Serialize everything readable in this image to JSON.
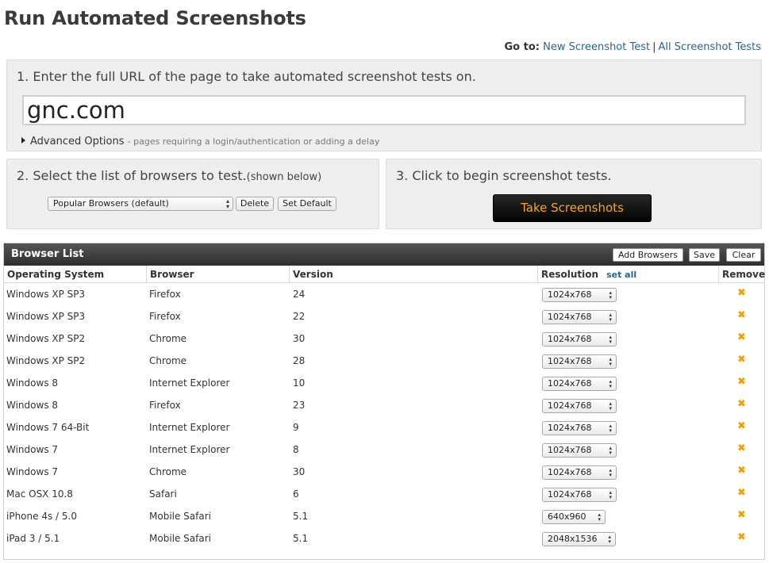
{
  "page": {
    "title": "Run Automated Screenshots"
  },
  "goto": {
    "label": "Go to:",
    "links": [
      "New Screenshot Test",
      "All Screenshot Tests"
    ],
    "separator": "|"
  },
  "step1": {
    "text": "1. Enter the full URL of the page to take automated screenshot tests on.",
    "url_value": "gnc.com",
    "advanced_label": "Advanced Options",
    "advanced_desc": "- pages requiring a login/authentication or adding a delay"
  },
  "step2": {
    "text": "2. Select the list of browsers to test.",
    "suffix": "(shown below)",
    "selected_list": "Popular Browsers (default)",
    "delete_label": "Delete",
    "set_default_label": "Set Default"
  },
  "step3": {
    "text": "3. Click to begin screenshot tests.",
    "button_label": "Take Screenshots",
    "button_text_color": "#f5a623"
  },
  "browser_list": {
    "title": "Browser List",
    "add_label": "Add Browsers",
    "save_label": "Save",
    "clear_label": "Clear",
    "columns": {
      "os": "Operating System",
      "browser": "Browser",
      "version": "Version",
      "resolution": "Resolution",
      "set_all": "set all",
      "remove": "Remove"
    },
    "remove_icon": "close-icon",
    "rows": [
      {
        "os": "Windows XP SP3",
        "browser": "Firefox",
        "version": "24",
        "resolution": "1024x768"
      },
      {
        "os": "Windows XP SP3",
        "browser": "Firefox",
        "version": "22",
        "resolution": "1024x768"
      },
      {
        "os": "Windows XP SP2",
        "browser": "Chrome",
        "version": "30",
        "resolution": "1024x768"
      },
      {
        "os": "Windows XP SP2",
        "browser": "Chrome",
        "version": "28",
        "resolution": "1024x768"
      },
      {
        "os": "Windows 8",
        "browser": "Internet Explorer",
        "version": "10",
        "resolution": "1024x768"
      },
      {
        "os": "Windows 8",
        "browser": "Firefox",
        "version": "23",
        "resolution": "1024x768"
      },
      {
        "os": "Windows 7 64-Bit",
        "browser": "Internet Explorer",
        "version": "9",
        "resolution": "1024x768"
      },
      {
        "os": "Windows 7",
        "browser": "Internet Explorer",
        "version": "8",
        "resolution": "1024x768"
      },
      {
        "os": "Windows 7",
        "browser": "Chrome",
        "version": "30",
        "resolution": "1024x768"
      },
      {
        "os": "Mac OSX 10.8",
        "browser": "Safari",
        "version": "6",
        "resolution": "1024x768"
      },
      {
        "os": "iPhone 4s / 5.0",
        "browser": "Mobile Safari",
        "version": "5.1",
        "resolution": "640x960"
      },
      {
        "os": "iPad 3 / 5.1",
        "browser": "Mobile Safari",
        "version": "5.1",
        "resolution": "2048x1536"
      }
    ]
  }
}
